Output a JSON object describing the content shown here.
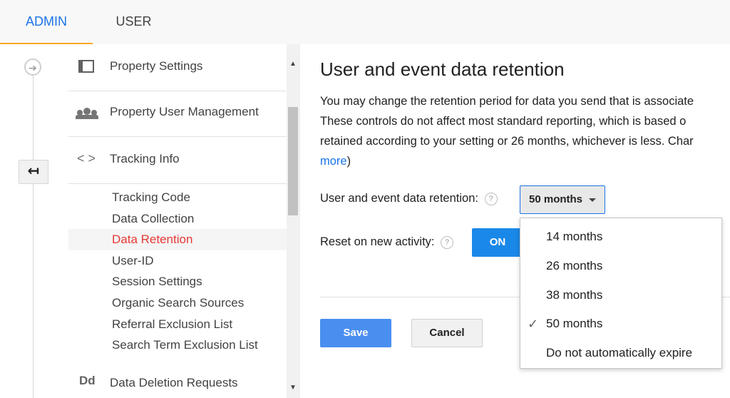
{
  "tabs": {
    "admin": "ADMIN",
    "user": "USER"
  },
  "nav": {
    "property_settings": "Property Settings",
    "property_user_management": "Property User Management",
    "tracking_info": "Tracking Info",
    "tracking_info_icon": "< >",
    "sub_items": [
      "Tracking Code",
      "Data Collection",
      "Data Retention",
      "User-ID",
      "Session Settings",
      "Organic Search Sources",
      "Referral Exclusion List",
      "Search Term Exclusion List"
    ],
    "active_item": "Data Retention",
    "data_deletion_requests": "Data Deletion Requests",
    "data_deletion_icon": "Dd"
  },
  "main": {
    "title": "User and event data retention",
    "description_lines": [
      "You may change the retention period for data you send that is associate",
      "These controls do not affect most standard reporting, which is based o",
      "retained according to your setting or 26 months, whichever is less. Char"
    ],
    "learn_more_link": "more",
    "learn_more_suffix": ")",
    "retention_label": "User and event data retention:",
    "retention_value": "50 months",
    "reset_label": "Reset on new activity:",
    "reset_toggle": "ON",
    "help_glyph": "?",
    "save_label": "Save",
    "cancel_label": "Cancel"
  },
  "dropdown": {
    "options": [
      "14 months",
      "26 months",
      "38 months",
      "50 months",
      "Do not automatically expire"
    ],
    "selected": "50 months",
    "check_glyph": "✓"
  },
  "colors": {
    "accent_blue": "#1a73e8",
    "active_red": "#e53935",
    "tab_underline": "#f9a825"
  }
}
